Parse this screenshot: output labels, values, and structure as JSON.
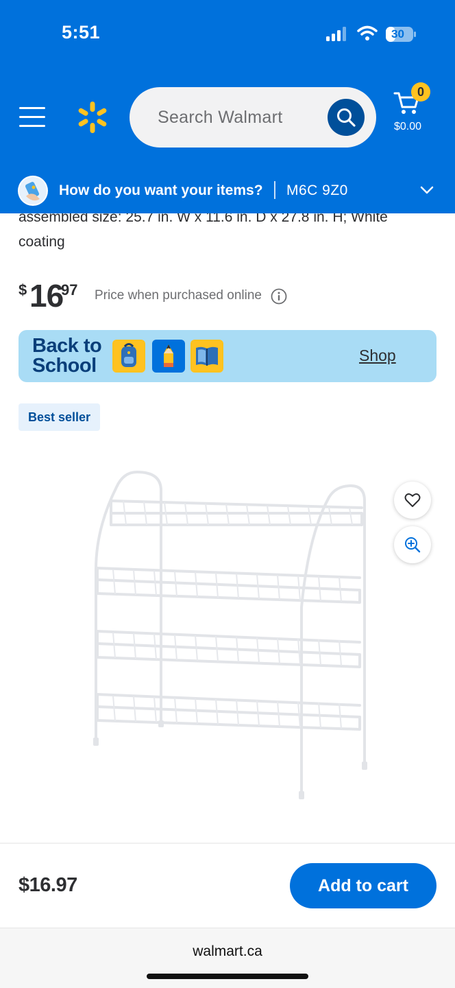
{
  "status_bar": {
    "time": "5:51",
    "battery_level": "30"
  },
  "header": {
    "search_placeholder": "Search Walmart",
    "cart_count": "0",
    "cart_total": "$0.00",
    "delivery_question": "How do you want your items?",
    "delivery_postal": "M6C 9Z0",
    "brand_color": "#0071dc",
    "spark_color": "#ffc220"
  },
  "product": {
    "description_line1": "assembled size: 25.7 in. W x 11.6 in. D x 27.8 in. H; White",
    "description_line2": "coating",
    "price_dollar": "$",
    "price_whole": "16",
    "price_cents": "97",
    "price_note": "Price when purchased online",
    "badge": "Best seller"
  },
  "promo": {
    "title_line1": "Back to",
    "title_line2": "School",
    "shop_label": "Shop",
    "icons": [
      "backpack-icon",
      "pencil-icon",
      "book-icon"
    ]
  },
  "bottom_bar": {
    "price": "$16.97",
    "add_to_cart_label": "Add to cart"
  },
  "browser": {
    "url": "walmart.ca"
  }
}
